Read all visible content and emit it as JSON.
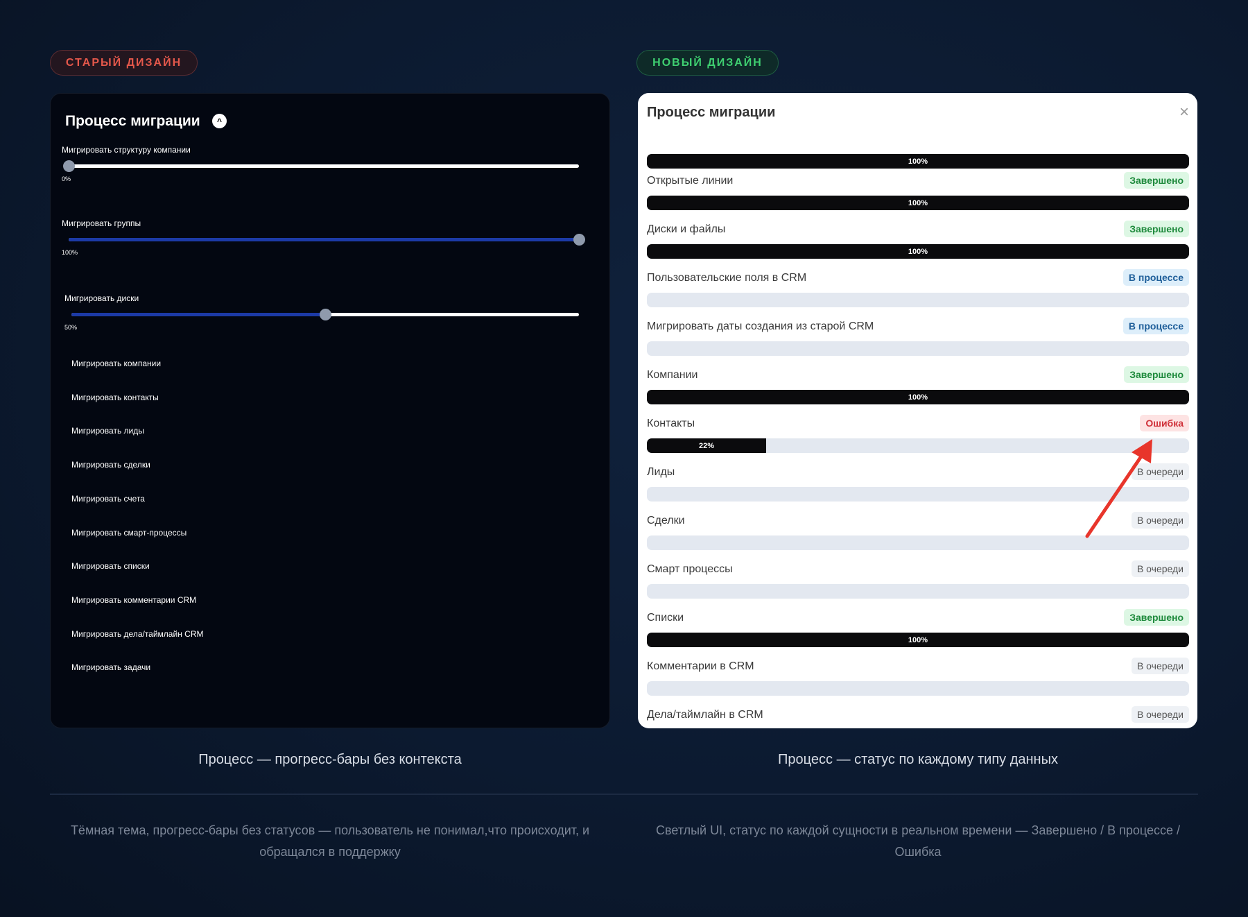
{
  "old": {
    "badge": "СТАРЫЙ ДИЗАЙН",
    "title": "Процесс миграции",
    "sliders": [
      {
        "label": "Мигрировать структуру компании",
        "value": 0,
        "value_label": "0%"
      },
      {
        "label": "Мигрировать группы",
        "value": 100,
        "value_label": "100%"
      },
      {
        "label": "Мигрировать диски",
        "value": 50,
        "value_label": "50%"
      }
    ],
    "items": [
      "Мигрировать компании",
      "Мигрировать контакты",
      "Мигрировать лиды",
      "Мигрировать сделки",
      "Мигрировать счета",
      "Мигрировать смарт-процессы",
      "Мигрировать списки",
      "Мигрировать комментарии CRM",
      "Мигрировать дела/таймлайн CRM",
      "Мигрировать задачи"
    ],
    "caption": "Процесс — прогресс-бары без контекста",
    "description": "Тёмная тема, прогресс-бары без статусов — пользователь не понимал,что происходит, и обращался в поддержку"
  },
  "new": {
    "badge": "НОВЫЙ ДИЗАЙН",
    "title": "Процесс миграции",
    "close": "×",
    "top_bar": {
      "progress": 100,
      "label": "100%"
    },
    "rows": [
      {
        "label": "Открытые линии",
        "status": "Завершено",
        "kind": "done",
        "progress": 100,
        "progress_label": "100%"
      },
      {
        "label": "Диски и файлы",
        "status": "Завершено",
        "kind": "done",
        "progress": 100,
        "progress_label": "100%"
      },
      {
        "label": "Пользовательские поля в CRM",
        "status": "В процессе",
        "kind": "prog",
        "progress": 0,
        "progress_label": ""
      },
      {
        "label": "Мигрировать даты создания из старой CRM",
        "status": "В процессе",
        "kind": "prog",
        "progress": 0,
        "progress_label": ""
      },
      {
        "label": "Компании",
        "status": "Завершено",
        "kind": "done",
        "progress": 100,
        "progress_label": "100%"
      },
      {
        "label": "Контакты",
        "status": "Ошибка",
        "kind": "err",
        "progress": 22,
        "progress_label": "22%"
      },
      {
        "label": "Лиды",
        "status": "В очереди",
        "kind": "queue",
        "progress": 0,
        "progress_label": ""
      },
      {
        "label": "Сделки",
        "status": "В очереди",
        "kind": "queue",
        "progress": 0,
        "progress_label": ""
      },
      {
        "label": "Смарт процессы",
        "status": "В очереди",
        "kind": "queue",
        "progress": 0,
        "progress_label": ""
      },
      {
        "label": "Списки",
        "status": "Завершено",
        "kind": "done",
        "progress": 100,
        "progress_label": "100%"
      },
      {
        "label": "Комментарии в CRM",
        "status": "В очереди",
        "kind": "queue",
        "progress": 0,
        "progress_label": ""
      },
      {
        "label": "Дела/таймлайн в CRM",
        "status": "В очереди",
        "kind": "queue",
        "progress": 0,
        "progress_label": ""
      }
    ],
    "caption": "Процесс — статус по каждому типу данных",
    "description": "Светлый UI, статус по каждой сущности в реальном времени — Завершено / В процессе / Ошибка"
  },
  "colors": {
    "arrow": "#e8352b"
  }
}
